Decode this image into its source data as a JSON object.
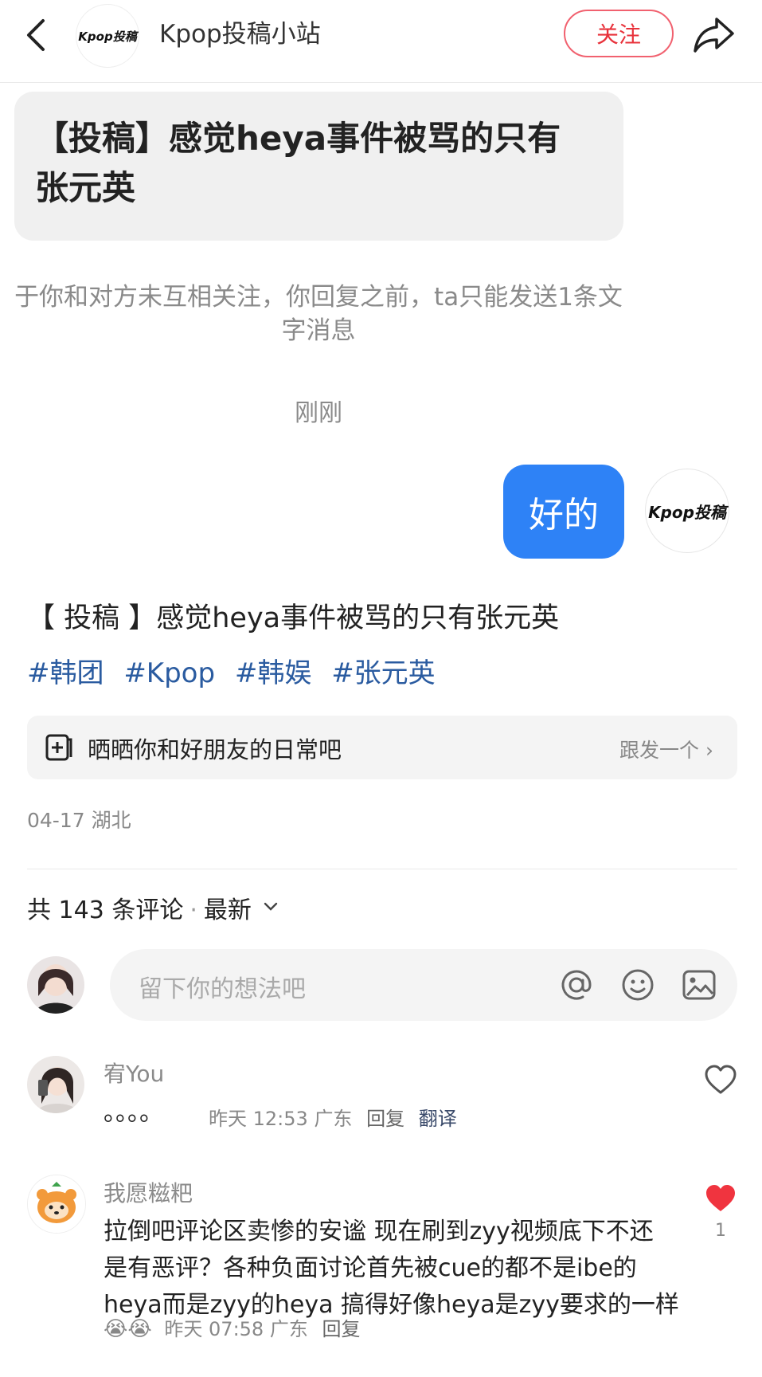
{
  "header": {
    "back_icon": "chevron-left-icon",
    "account_logo_text": "Kpop投稿",
    "title": "Kpop投稿小站",
    "follow_label": "关注",
    "share_icon": "share-arrow-icon"
  },
  "chat": {
    "quote_text": "【投稿】感觉heya事件被骂的只有张元英",
    "system_note_line1": "于你和对方未互相关注，你回复之前，ta只能发送1条文",
    "system_note_line2": "字消息",
    "timestamp": "刚刚",
    "reply_bubble": "好的",
    "reply_avatar_text": "Kpop投稿"
  },
  "post": {
    "title": "【 投稿 】感觉heya事件被骂的只有张元英",
    "tags": [
      "#韩团",
      "#Kpop",
      "#韩娱",
      "#张元英"
    ]
  },
  "share_bar": {
    "icon": "add-note-icon",
    "label": "晒晒你和好朋友的日常吧",
    "action": "跟发一个 ›"
  },
  "meta": {
    "date_location": "04-17 湖北"
  },
  "comments_header": {
    "count_text": "共 143 条评论",
    "separator": "·",
    "sort_label": "最新"
  },
  "comment_input": {
    "placeholder": "留下你的想法吧",
    "icons": [
      "at-icon",
      "emoji-icon",
      "image-icon"
    ]
  },
  "comments": [
    {
      "name": "宥You",
      "text": "。。。。",
      "time": "昨天 12:53",
      "location": "广东",
      "reply": "回复",
      "translate": "翻译",
      "liked": false,
      "likes": ""
    },
    {
      "name": "我愿糍粑",
      "text_lines": [
        "拉倒吧评论区卖惨的安谧 现在刷到zyy视频底下不还",
        "是有恶评？各种负面讨论首先被cue的都不是ibe的",
        "heya而是zyy的heya 搞得好像heya是zyy要求的一样"
      ],
      "emojis": "😭😭",
      "time": "昨天 07:58",
      "location": "广东",
      "reply": "回复",
      "liked": true,
      "likes": "1"
    }
  ],
  "colors": {
    "accent_red": "#e8323b",
    "bubble_blue": "#2e82f6",
    "tag_blue": "#2a5ba0"
  }
}
